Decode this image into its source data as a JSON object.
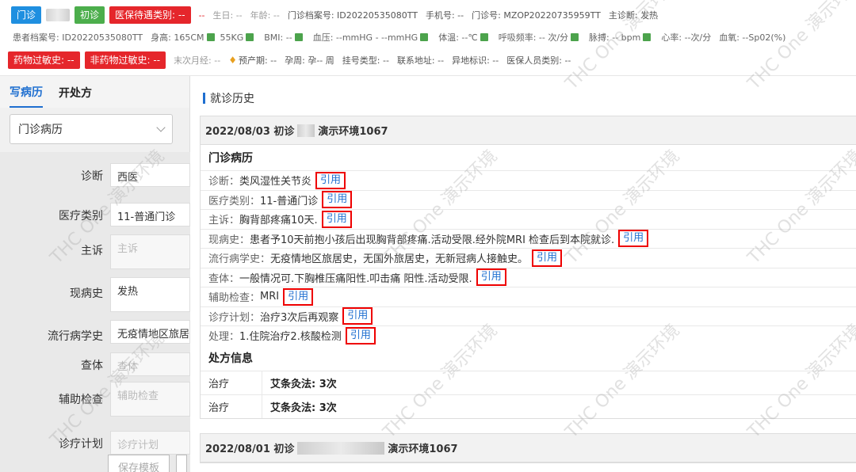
{
  "header": {
    "visit_type_tag": "门诊",
    "first_visit_tag": "初诊",
    "insurance_tag": "医保待遇类别: --",
    "insurance_extra": "--",
    "birthday": "生日: --",
    "age": "年龄: --",
    "record_no": "门诊档案号: ID20220535080TT",
    "phone": "手机号: --",
    "outpatient_no": "门诊号: MZOP20220735959TT",
    "main_diagnosis": "主诊断: 发热",
    "patient_record": "患者档案号: ID20220535080TT",
    "height": "身高: 165CM",
    "weight": "55KG",
    "bmi": "BMI: --",
    "bp": "血压: --mmHG - --mmHG",
    "temp": "体温: --℃",
    "resp": "呼吸频率: -- 次/分",
    "pulse": "脉搏: -- bpm",
    "heart": "心率: --次/分",
    "spo2": "血氧: --Sp02(%)",
    "drug_allergy": "药物过敏史: --",
    "nondrug_allergy": "非药物过敏史: --",
    "last_period": "末次月经: --",
    "due_date": "预产期: --",
    "preg_week": "孕周: 孕-- 周",
    "reg_type": "挂号类型: --",
    "address": "联系地址: --",
    "remote_flag": "异地标识: --",
    "insured_type": "医保人员类别: --"
  },
  "left": {
    "tab_write": "写病历",
    "tab_prescribe": "开处方",
    "record_type": "门诊病历",
    "fields": [
      {
        "label": "诊断",
        "value": "西医",
        "placeholder": false
      },
      {
        "label": "医疗类别",
        "value": "11-普通门诊",
        "placeholder": false
      },
      {
        "label": "主诉",
        "value": "主诉",
        "placeholder": true
      },
      {
        "label": "现病史",
        "value": "发热",
        "placeholder": false
      },
      {
        "label": "流行病学史",
        "value": "无疫情地区旅居",
        "placeholder": false
      },
      {
        "label": "查体",
        "value": "查体",
        "placeholder": true
      },
      {
        "label": "辅助检查",
        "value": "辅助检查",
        "placeholder": true
      },
      {
        "label": "诊疗计划",
        "value": "诊疗计划",
        "placeholder": true
      }
    ],
    "save_template": "保存模板"
  },
  "right": {
    "section_title": "就诊历史",
    "visits": [
      {
        "date_type": "2022/08/03 初诊",
        "clinic": "演示环境1067",
        "record_title": "门诊病历",
        "rows": [
          {
            "key": "诊断：",
            "value": "类风湿性关节炎"
          },
          {
            "key": "医疗类别：",
            "value": "11-普通门诊"
          },
          {
            "key": "主诉：",
            "value": "胸背部疼痛10天."
          },
          {
            "key": "现病史：",
            "value": "患者予10天前抱小孩后出现胸背部疼痛.活动受限.经外院MRI 检查后到本院就诊."
          },
          {
            "key": "流行病学史：",
            "value": "无疫情地区旅居史，无国外旅居史，无新冠病人接触史。"
          },
          {
            "key": "查体：",
            "value": "一般情况可.下胸椎压痛阳性.叩击痛 阳性.活动受限."
          },
          {
            "key": "辅助检查：",
            "value": "MRI"
          },
          {
            "key": "诊疗计划：",
            "value": "治疗3次后再观察"
          },
          {
            "key": "处理：",
            "value": "1.住院治疗2.核酸检测"
          }
        ],
        "quote_label": "引用",
        "rx_title": "处方信息",
        "rx": [
          {
            "type": "治疗",
            "item": "艾条灸法: 3次"
          },
          {
            "type": "治疗",
            "item": "艾条灸法: 3次"
          }
        ]
      },
      {
        "date_type": "2022/08/01 初诊",
        "clinic": "演示环境1067"
      }
    ]
  },
  "watermark": "THC One 演示环境"
}
